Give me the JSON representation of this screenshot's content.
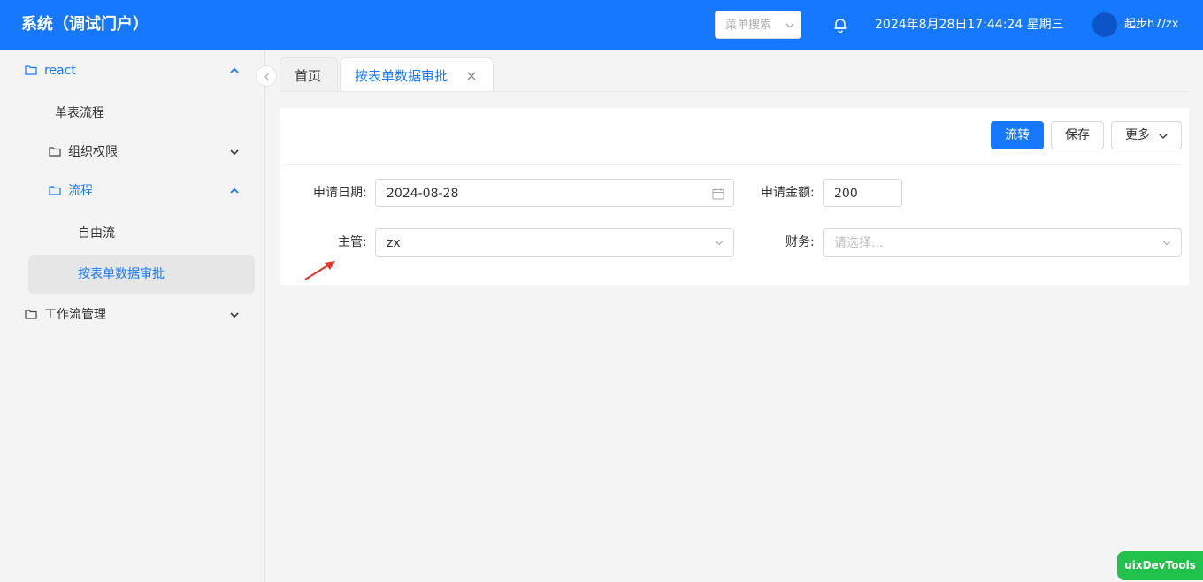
{
  "header": {
    "title": "系统（调试门户）",
    "menu_search_placeholder": "菜单搜索",
    "datetime": "2024年8月28日17:44:24 星期三",
    "username": "起步h7/zx"
  },
  "sidebar": {
    "items": [
      {
        "label": "react",
        "icon": "folder-icon",
        "arrow": "chevron-up-icon"
      },
      {
        "label": "单表流程"
      },
      {
        "label": "组织权限",
        "icon": "folder-icon",
        "arrow": "chevron-down-icon"
      },
      {
        "label": "流程",
        "icon": "folder-icon",
        "arrow": "chevron-up-icon"
      },
      {
        "label": "自由流"
      },
      {
        "label": "按表单数据审批",
        "selected": true
      },
      {
        "label": "工作流管理",
        "icon": "folder-icon",
        "arrow": "chevron-down-icon"
      }
    ]
  },
  "tabs": [
    {
      "label": "首页",
      "active": false
    },
    {
      "label": "按表单数据审批",
      "active": true
    }
  ],
  "toolbar": {
    "transfer_label": "流转",
    "save_label": "保存",
    "more_label": "更多"
  },
  "form": {
    "apply_date_label": "申请日期:",
    "apply_date_value": "2024-08-28",
    "apply_amount_label": "申请金额:",
    "apply_amount_value": "200",
    "supervisor_label": "主管:",
    "supervisor_value": "zx",
    "finance_label": "财务:",
    "finance_placeholder": "请选择..."
  },
  "devtools_label": "uixDevTools",
  "colors": {
    "primary": "#1677ff",
    "header_bg": "#1677ff",
    "devtools_bg": "#21c24a",
    "annotation_arrow": "#e8322b"
  }
}
